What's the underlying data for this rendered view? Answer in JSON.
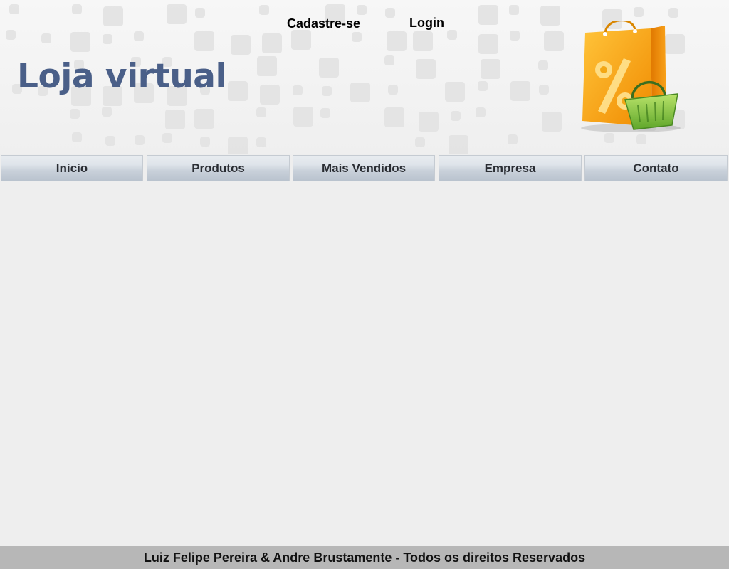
{
  "header": {
    "register_link": "Cadastre-se",
    "login_link": "Login",
    "site_title": "Loja virtual",
    "logo_icon": "shopping-bag-percent-icon",
    "basket_icon": "shopping-basket-icon"
  },
  "nav": {
    "items": [
      {
        "label": "Inicio"
      },
      {
        "label": "Produtos"
      },
      {
        "label": "Mais Vendidos"
      },
      {
        "label": "Empresa"
      },
      {
        "label": "Contato"
      }
    ]
  },
  "footer": {
    "text": "Luiz Felipe Pereira & Andre Brustamente - Todos os direitos Reservados"
  },
  "colors": {
    "title": "#4a5f88",
    "background": "#eeeeee",
    "footer": "#b7b7b7",
    "bag": "#f5a623",
    "basket": "#8cc63f"
  }
}
